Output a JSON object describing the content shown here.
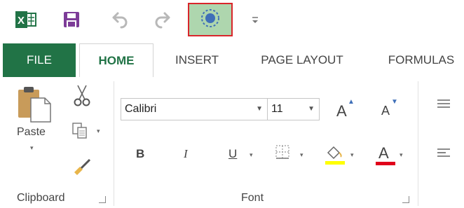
{
  "qat": {
    "excel_icon": "excel-logo-icon",
    "save_icon": "save-icon",
    "undo_icon": "undo-icon",
    "redo_icon": "redo-icon",
    "record_icon": "record-icon",
    "customize_icon": "customize-qat-icon"
  },
  "tabs": {
    "file": "FILE",
    "home": "HOME",
    "insert": "INSERT",
    "page_layout": "PAGE LAYOUT",
    "formulas": "FORMULAS"
  },
  "clipboard": {
    "paste_label": "Paste",
    "group_label": "Clipboard"
  },
  "font": {
    "family": "Calibri",
    "size": "11",
    "group_label": "Font",
    "bold": "B",
    "italic": "I",
    "underline": "U",
    "font_color_letter": "A",
    "grow_letter": "A",
    "shrink_letter": "A"
  },
  "colors": {
    "accent": "#217346",
    "record_bg": "#aed6ae",
    "record_border": "#d9262b",
    "highlight_bar": "#ffff00",
    "font_color_bar": "#e0001b"
  }
}
